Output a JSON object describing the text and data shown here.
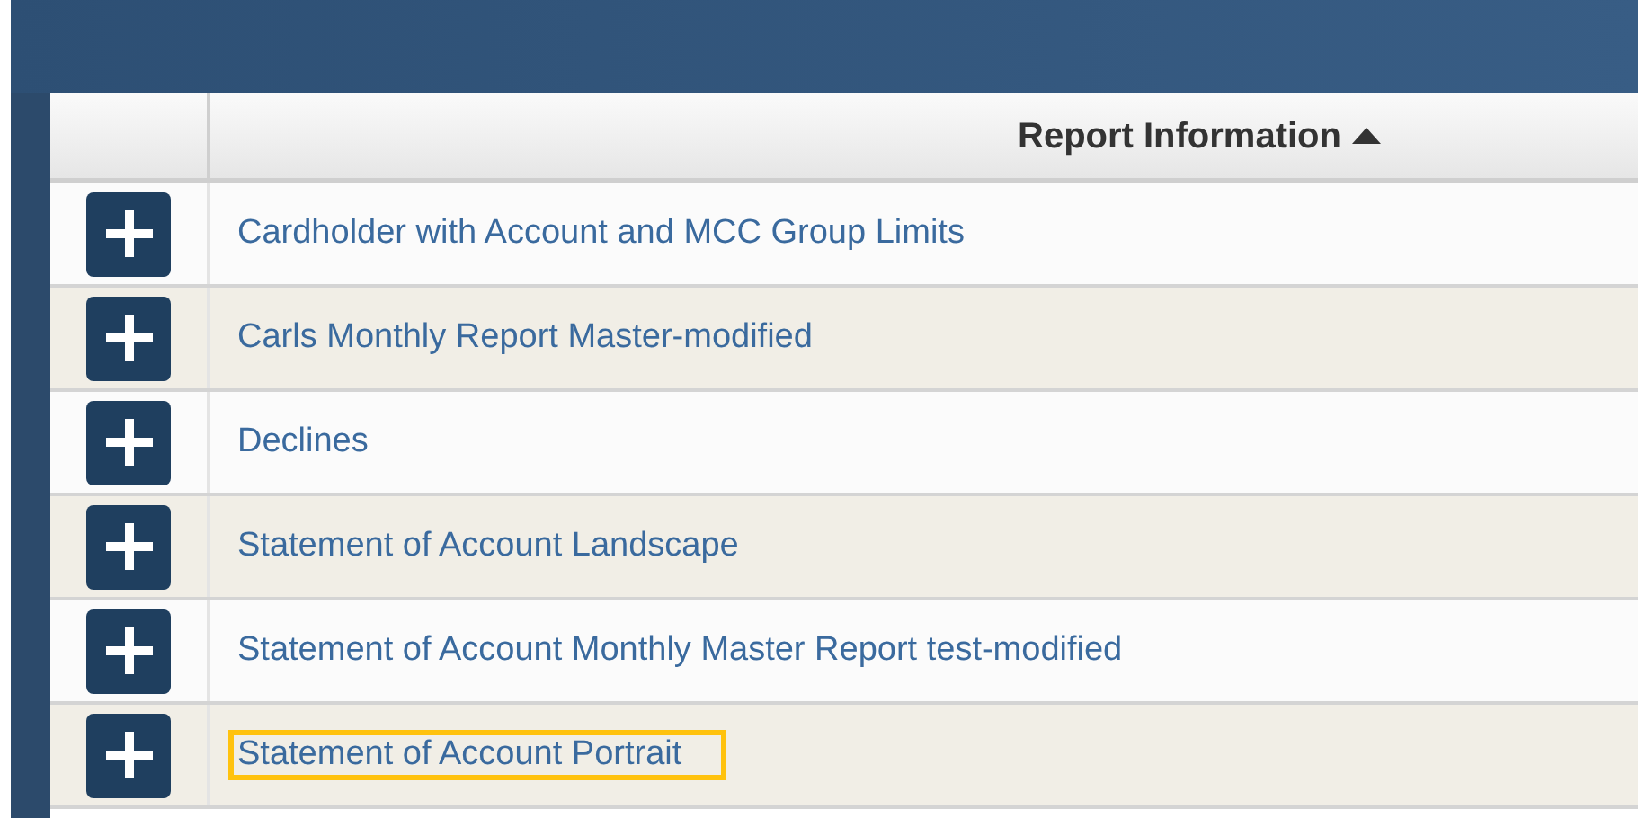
{
  "table": {
    "header": {
      "label": "Report Information",
      "sorted_ascending": true
    },
    "rows": [
      {
        "title": "Cardholder with Account and MCC Group Limits",
        "focused": false
      },
      {
        "title": "Carls Monthly Report Master-modified",
        "focused": false
      },
      {
        "title": "Declines",
        "focused": false
      },
      {
        "title": "Statement of Account Landscape",
        "focused": false
      },
      {
        "title": "Statement of Account Monthly Master Report test-modified",
        "focused": false
      },
      {
        "title": "Statement of Account Portrait",
        "focused": true
      }
    ]
  }
}
